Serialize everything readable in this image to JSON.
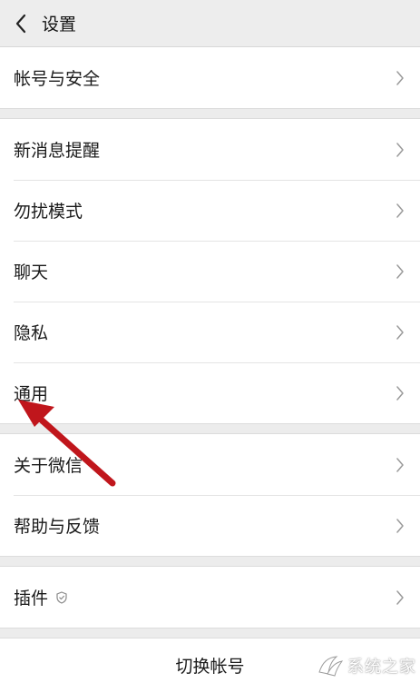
{
  "header": {
    "title": "设置"
  },
  "groups": [
    {
      "items": [
        {
          "label": "帐号与安全"
        }
      ]
    },
    {
      "items": [
        {
          "label": "新消息提醒"
        },
        {
          "label": "勿扰模式"
        },
        {
          "label": "聊天"
        },
        {
          "label": "隐私"
        },
        {
          "label": "通用"
        }
      ]
    },
    {
      "items": [
        {
          "label": "关于微信"
        },
        {
          "label": "帮助与反馈"
        }
      ]
    },
    {
      "items": [
        {
          "label": "插件"
        }
      ]
    }
  ],
  "footer": {
    "switch_account_label": "切换帐号"
  },
  "watermark": {
    "text": "系统之家"
  },
  "icons": {
    "back": "chevron-left-icon",
    "row": "chevron-right-icon",
    "plugin_badge": "shield-badge-icon"
  },
  "colors": {
    "background": "#ececec",
    "row_background": "#ffffff",
    "annotation_arrow": "#c0161c"
  }
}
